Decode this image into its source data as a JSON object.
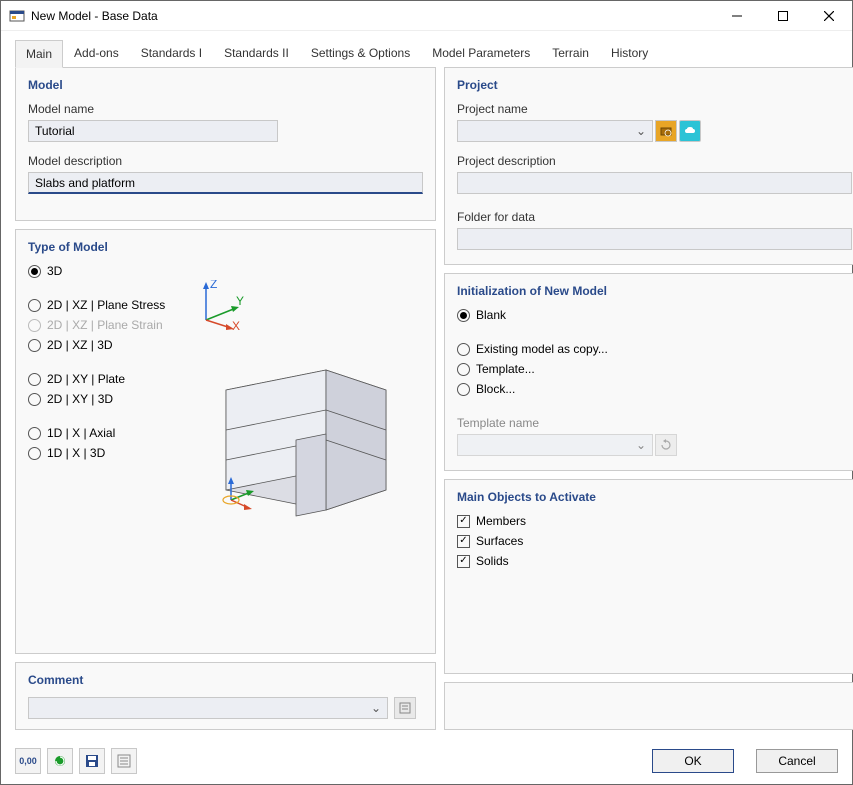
{
  "window": {
    "title": "New Model - Base Data"
  },
  "tabs": {
    "main": "Main",
    "addons": "Add-ons",
    "std1": "Standards I",
    "std2": "Standards II",
    "settings": "Settings & Options",
    "params": "Model Parameters",
    "terrain": "Terrain",
    "history": "History"
  },
  "model": {
    "title": "Model",
    "name_label": "Model name",
    "name_value": "Tutorial",
    "desc_label": "Model description",
    "desc_value": "Slabs and platform"
  },
  "project": {
    "title": "Project",
    "name_label": "Project name",
    "desc_label": "Project description",
    "folder_label": "Folder for data"
  },
  "type": {
    "title": "Type of Model",
    "r3d": "3D",
    "r2d_xz_ps": "2D | XZ | Plane Stress",
    "r2d_xz_pstrain": "2D | XZ | Plane Strain",
    "r2d_xz_3d": "2D | XZ | 3D",
    "r2d_xy_plate": "2D | XY | Plate",
    "r2d_xy_3d": "2D | XY | 3D",
    "r1d_x_axial": "1D | X | Axial",
    "r1d_x_3d": "1D | X | 3D"
  },
  "init": {
    "title": "Initialization of New Model",
    "blank": "Blank",
    "existing": "Existing model as copy...",
    "template": "Template...",
    "block": "Block...",
    "tmpl_label": "Template name"
  },
  "activate": {
    "title": "Main Objects to Activate",
    "members": "Members",
    "surfaces": "Surfaces",
    "solids": "Solids"
  },
  "comment": {
    "title": "Comment"
  },
  "buttons": {
    "ok": "OK",
    "cancel": "Cancel"
  }
}
